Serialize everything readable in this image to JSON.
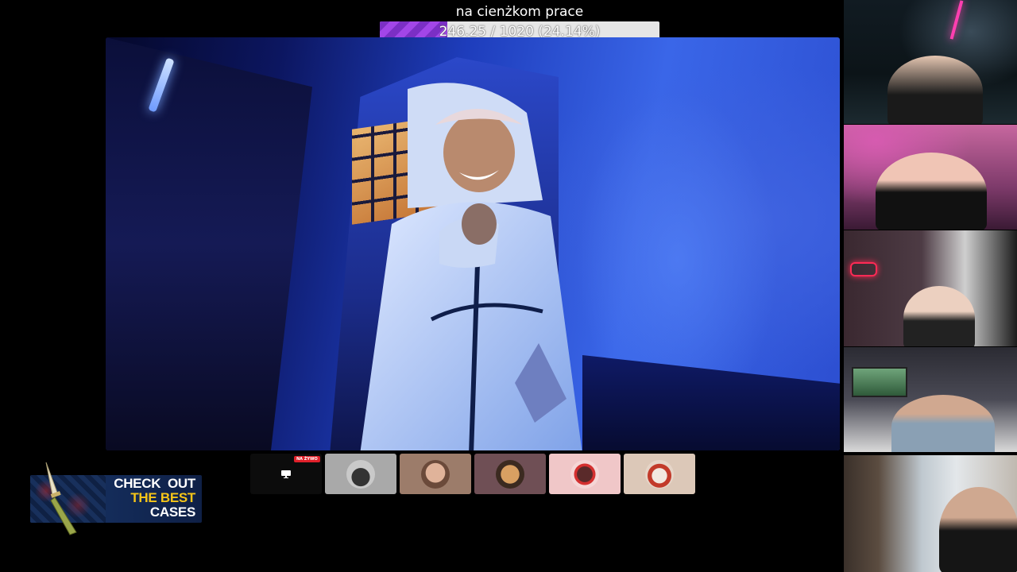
{
  "goal": {
    "title": "na cienżkom prace",
    "progress_text": "246.25 / 1020 (24.14%)",
    "progress_fraction": 0.2414,
    "fill_color": "#8e3ad8",
    "track_color": "#e6e6e6"
  },
  "participants": {
    "live_badge": "NA ŻYWO",
    "tiles": [
      {
        "name": "screen-share",
        "bg": "#0c0c0c"
      },
      {
        "name": "car",
        "bg": "#a9a9a9"
      },
      {
        "name": "bald-man",
        "bg": "#9c7c6a"
      },
      {
        "name": "glasses-cartoon",
        "bg": "#6f4f55"
      },
      {
        "name": "avatar-nf",
        "bg": "#f0c7c8"
      },
      {
        "name": "santa",
        "bg": "#dcc8b8"
      }
    ]
  },
  "ad": {
    "line1": "CHECK  OUT",
    "line2": "THE BEST",
    "line3": "CASES"
  },
  "icons": {
    "monitor": "monitor-icon",
    "knife": "knife-icon"
  }
}
